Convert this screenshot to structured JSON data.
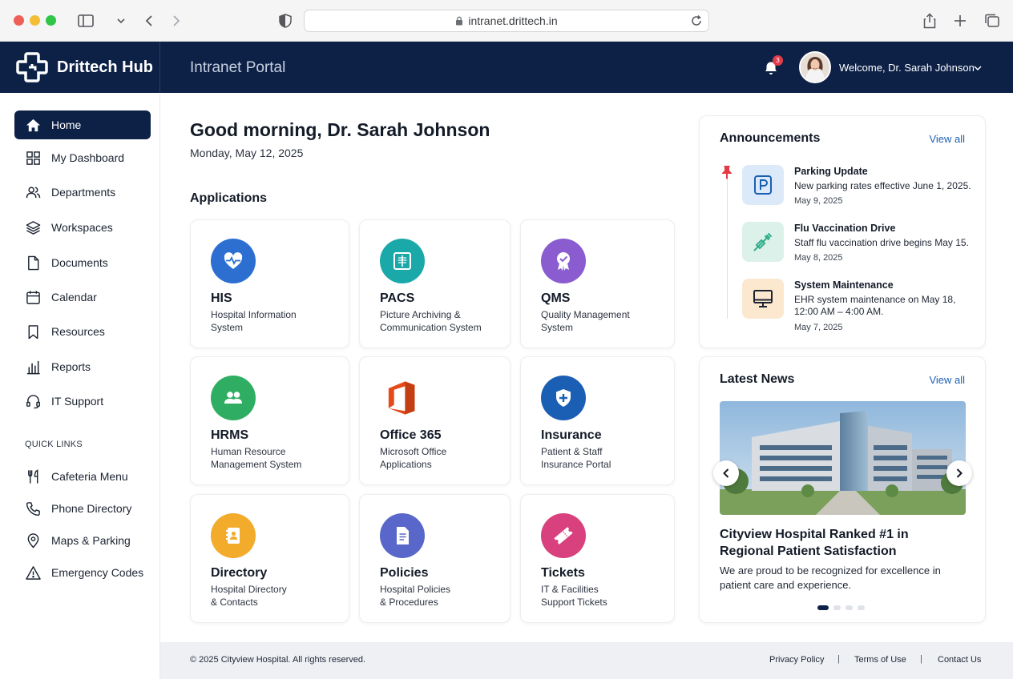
{
  "browser": {
    "url": "intranet.drittech.in"
  },
  "header": {
    "brand": "Drittech Hub",
    "portal_title": "Intranet Portal",
    "notification_count": "3",
    "welcome": "Welcome, Dr. Sarah Johnson"
  },
  "sidebar": {
    "items": [
      {
        "label": "Home",
        "icon": "home-icon"
      },
      {
        "label": "My Dashboard",
        "icon": "dashboard-icon"
      },
      {
        "label": "Departments",
        "icon": "users-icon"
      },
      {
        "label": "Workspaces",
        "icon": "layers-icon"
      },
      {
        "label": "Documents",
        "icon": "document-icon"
      },
      {
        "label": "Calendar",
        "icon": "calendar-icon"
      },
      {
        "label": "Resources",
        "icon": "bookmark-icon"
      },
      {
        "label": "Reports",
        "icon": "bar-chart-icon"
      },
      {
        "label": "IT Support",
        "icon": "headset-icon"
      }
    ],
    "quick_links_title": "QUICK LINKS",
    "quick_links": [
      {
        "label": "Cafeteria Menu",
        "icon": "cutlery-icon"
      },
      {
        "label": "Phone Directory",
        "icon": "phone-icon"
      },
      {
        "label": "Maps & Parking",
        "icon": "map-pin-icon"
      },
      {
        "label": "Emergency Codes",
        "icon": "warning-icon"
      }
    ]
  },
  "main": {
    "greeting": "Good morning, Dr. Sarah Johnson",
    "date": "Monday, May 12, 2025",
    "applications_title": "Applications",
    "apps": [
      {
        "name": "HIS",
        "desc_1": "Hospital Information",
        "desc_2": "System",
        "icon": "heart-pulse-icon",
        "color": "#2c6fd1"
      },
      {
        "name": "PACS",
        "desc_1": "Picture Archiving &",
        "desc_2": "Communication System",
        "icon": "xray-icon",
        "color": "#1ba8a8"
      },
      {
        "name": "QMS",
        "desc_1": "Quality Management",
        "desc_2": "System",
        "icon": "quality-badge-icon",
        "color": "#8a5cd0"
      },
      {
        "name": "HRMS",
        "desc_1": "Human Resource",
        "desc_2": "Management System",
        "icon": "people-icon",
        "color": "#2fae63"
      },
      {
        "name": "Office 365",
        "desc_1": "Microsoft Office",
        "desc_2": "Applications",
        "icon": "office-icon",
        "color": "#e64a19"
      },
      {
        "name": "Insurance",
        "desc_1": "Patient & Staff",
        "desc_2": "Insurance Portal",
        "icon": "shield-plus-icon",
        "color": "#1a5fb4"
      },
      {
        "name": "Directory",
        "desc_1": "Hospital Directory",
        "desc_2": "& Contacts",
        "icon": "contact-book-icon",
        "color": "#f2ab2b"
      },
      {
        "name": "Policies",
        "desc_1": "Hospital Policies",
        "desc_2": "& Procedures",
        "icon": "policy-document-icon",
        "color": "#5867c9"
      },
      {
        "name": "Tickets",
        "desc_1": "IT & Facilities",
        "desc_2": "Support Tickets",
        "icon": "ticket-icon",
        "color": "#d8417e"
      }
    ]
  },
  "announcements": {
    "title": "Announcements",
    "view_all": "View all",
    "items": [
      {
        "title": "Parking Update",
        "text_1": "New parking rates effective June 1, 2025.",
        "text_2": "",
        "date": "May 9, 2025",
        "icon": "parking-icon"
      },
      {
        "title": "Flu Vaccination Drive",
        "text_1": "Staff flu vaccination drive begins May 15.",
        "text_2": "",
        "date": "May 8, 2025",
        "icon": "syringe-icon"
      },
      {
        "title": "System Maintenance",
        "text_1": "EHR system maintenance on May 18,",
        "text_2": "12:00 AM – 4:00 AM.",
        "date": "May 7, 2025",
        "icon": "monitor-icon"
      }
    ]
  },
  "news": {
    "title": "Latest News",
    "view_all": "View all",
    "headline": "Cityview Hospital Ranked #1 in Regional Patient Satisfaction",
    "text": "We are proud to be recognized for excellence in patient care and experience.",
    "slide_count": 4,
    "active_slide": 1
  },
  "footer": {
    "copyright": "© 2025 Cityview Hospital. All rights reserved.",
    "links": [
      "Privacy Policy",
      "Terms of Use",
      "Contact Us"
    ]
  }
}
